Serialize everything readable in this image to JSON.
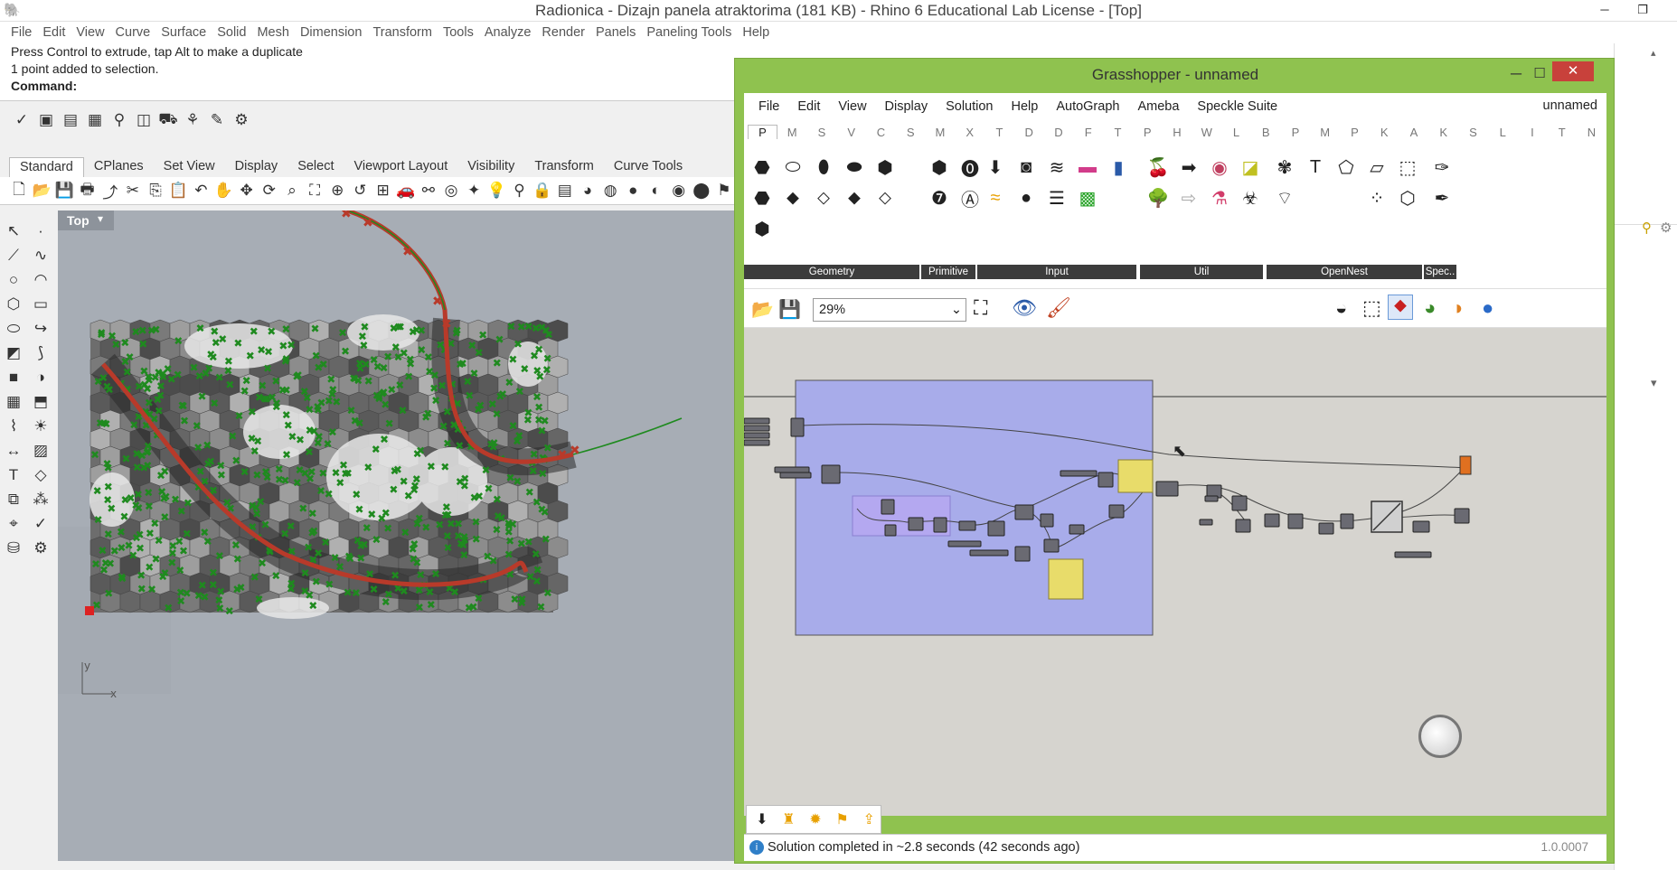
{
  "window": {
    "title": "Radionica - Dizajn panela atraktorima (181 KB) - Rhino 6 Educational Lab License - [Top]"
  },
  "menu": [
    "File",
    "Edit",
    "View",
    "Curve",
    "Surface",
    "Solid",
    "Mesh",
    "Dimension",
    "Transform",
    "Tools",
    "Analyze",
    "Render",
    "Panels",
    "Paneling Tools",
    "Help"
  ],
  "command": {
    "history": [
      "Press Control to extrude, tap Alt to make a duplicate",
      "1 point added to selection."
    ],
    "prompt": "Command:"
  },
  "toolbar_tabs": [
    "Standard",
    "CPlanes",
    "Set View",
    "Display",
    "Select",
    "Viewport Layout",
    "Visibility",
    "Transform",
    "Curve Tools"
  ],
  "viewport": {
    "name": "Top",
    "axis_x": "x",
    "axis_y": "y"
  },
  "grasshopper": {
    "title": "Grasshopper - unnamed",
    "document_name": "unnamed",
    "menu": [
      "File",
      "Edit",
      "View",
      "Display",
      "Solution",
      "Help",
      "AutoGraph",
      "Ameba",
      "Speckle Suite"
    ],
    "tabs": [
      "P",
      "M",
      "S",
      "V",
      "C",
      "S",
      "M",
      "X",
      "T",
      "D",
      "D",
      "F",
      "T",
      "P",
      "H",
      "W",
      "L",
      "B",
      "P",
      "M",
      "P",
      "K",
      "A",
      "K",
      "S",
      "L",
      "I",
      "T",
      "N"
    ],
    "groups": [
      "Geometry",
      "Primitive",
      "Input",
      "Util",
      "OpenNest",
      "Spec.."
    ],
    "zoom": "29%",
    "status": "Solution completed in ~2.8 seconds (42 seconds ago)",
    "version": "1.0.0007"
  },
  "colors": {
    "gh_frame": "#8fc24f",
    "gh_close": "#c8413b",
    "group_fill": "#a8acea",
    "panel_yellow": "#e8dc6a",
    "attractor_curve": "#b83a2a",
    "points": "#1f8a1f"
  }
}
